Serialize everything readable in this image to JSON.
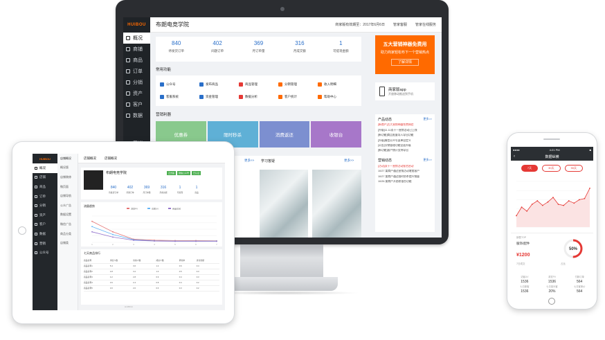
{
  "monitor": {
    "logo": "HUIBOU",
    "title": "布朗电竞学院",
    "expire": "商家版有效期至：2017年6月6日",
    "links": [
      "管家客服",
      "管家在线服务"
    ],
    "nav": [
      "概况",
      "商铺",
      "商品",
      "订单",
      "分销",
      "资产",
      "客户",
      "数据",
      "营销"
    ],
    "stats": [
      {
        "value": "840",
        "label": "待发货订单"
      },
      {
        "value": "402",
        "label": "间题订单"
      },
      {
        "value": "369",
        "label": "月订单量"
      },
      {
        "value": "316",
        "label": "月成交额"
      },
      {
        "value": "1",
        "label": "可提现金额"
      }
    ],
    "banner": {
      "title": "五大营销神器免费用",
      "subtitle": "助力商家轻松布下一个营销热点",
      "button": "了解详情"
    },
    "app": {
      "title": "商家版app",
      "subtitle": "开放移动推送到手机"
    },
    "quick_title": "常用功能",
    "quick": [
      {
        "label": "公众号",
        "color": "#2a6fc9"
      },
      {
        "label": "发布商品",
        "color": "#2a6fc9"
      },
      {
        "label": "商品管理",
        "color": "#e53935"
      },
      {
        "label": "分销管理",
        "color": "#ff6a00"
      },
      {
        "label": "收入明细",
        "color": "#ff6a00"
      },
      {
        "label": "客服系统",
        "color": "#2a6fc9"
      },
      {
        "label": "资金管理",
        "color": "#2a6fc9"
      },
      {
        "label": "数据分析",
        "color": "#e53935"
      },
      {
        "label": "客户统计",
        "color": "#ff6a00"
      },
      {
        "label": "帮助中心",
        "color": "#ff6a00"
      }
    ],
    "tools_title": "营销利器",
    "tools": [
      {
        "label": "优惠券",
        "color": "#89c98d"
      },
      {
        "label": "限时秒杀",
        "color": "#5fb0d6"
      },
      {
        "label": "消费返还",
        "color": "#7c8fd0"
      },
      {
        "label": "收银台",
        "color": "#a777c9"
      }
    ],
    "news_title": "产品动态",
    "news_more": "更多>>",
    "news": [
      {
        "text": "[新商户]五大营销神器免费体验",
        "red": true
      },
      {
        "text": "[升级]11.11双十一营销活动已上线",
        "red": false
      },
      {
        "text": "[新功能]商品批量导入导出功能",
        "red": false
      },
      {
        "text": "[升级]微信公众号菜单自定义",
        "red": false
      },
      {
        "text": "[公告]分销管理功能全面升级",
        "red": false
      },
      {
        "text": "[新功能]客户统计支持导出",
        "red": false
      }
    ],
    "news2_title": "营销动态",
    "news2": [
      {
        "text": "[活动]双十一营销活动报名启动",
        "red": true
      },
      {
        "text": "10/27 某商户通过营销活动增加客户",
        "red": false
      },
      {
        "text": "10/27 某商户通过限时秒杀提升销量",
        "red": false
      },
      {
        "text": "10/26 某商户开启收银台功能",
        "red": false
      }
    ],
    "learn_title": "学习答疑",
    "more": "更多>>"
  },
  "tablet": {
    "logo": "HUIBOU",
    "top_tabs": [
      "店铺概况",
      "店铺概况"
    ],
    "nav": [
      "概况",
      "店铺",
      "商品",
      "订单",
      "分销",
      "资产",
      "客户",
      "数据",
      "营销",
      "公众号"
    ],
    "sub": [
      "店铺概况",
      "概况版",
      "店铺装修",
      "微页面",
      "店铺导航",
      "公众广告",
      "数据设置",
      "微信广告",
      "商品分类",
      "店铺类"
    ],
    "shop_name": "布朗电竞学院",
    "tags": [
      {
        "label": "正式版",
        "color": "#4caf50"
      },
      {
        "label": "微信公众号",
        "color": "#4caf50"
      },
      {
        "label": "已认证",
        "color": "#4caf50"
      }
    ],
    "stats": [
      {
        "value": "840",
        "label": "待发货订单"
      },
      {
        "value": "402",
        "label": "间题订单"
      },
      {
        "value": "369",
        "label": "月订单量"
      },
      {
        "value": "316",
        "label": "月成交额"
      },
      {
        "value": "1",
        "label": "可提现"
      },
      {
        "value": "1",
        "label": "商品"
      }
    ],
    "chart_title": "流量趋势",
    "legend": [
      "浏览PV",
      "访客UV",
      "商品访问"
    ],
    "chart_data": {
      "type": "line",
      "x": [
        "1",
        "2",
        "3",
        "4",
        "5",
        "6",
        "7"
      ],
      "series": [
        {
          "name": "浏览PV",
          "values": [
            80,
            40,
            12,
            8,
            7,
            7,
            6
          ]
        },
        {
          "name": "访客UV",
          "values": [
            60,
            30,
            10,
            6,
            5,
            5,
            5
          ]
        },
        {
          "name": "商品访问",
          "values": [
            40,
            20,
            8,
            5,
            4,
            4,
            4
          ]
        }
      ]
    },
    "table_title": "七天商品排行",
    "table_head": [
      "商品名称",
      "浏览人数",
      "访客人数",
      "成交人数",
      "转化率",
      "支付金额"
    ],
    "table_rows": [
      [
        "商品名称1",
        "5.4",
        "3.6",
        "1.2",
        "0.6",
        "0.4"
      ],
      [
        "商品名称2",
        "4.8",
        "3.2",
        "1.0",
        "0.5",
        "0.3"
      ],
      [
        "商品名称3",
        "4.2",
        "2.8",
        "0.9",
        "0.4",
        "0.3"
      ],
      [
        "商品名称4",
        "3.6",
        "2.4",
        "0.8",
        "0.4",
        "0.2"
      ],
      [
        "商品名称5",
        "3.0",
        "2.0",
        "0.6",
        "0.3",
        "0.2"
      ]
    ],
    "footer": "HUIBOU"
  },
  "phone": {
    "status_left": "●●●●",
    "status_time": "4:21 PM",
    "status_right": "■",
    "title": "数据纵横",
    "tabs": [
      "7天",
      "30天",
      "90天"
    ],
    "chart_data": {
      "type": "area",
      "x": [
        "1",
        "2",
        "3",
        "4",
        "5",
        "6",
        "7",
        "8",
        "9",
        "10",
        "11",
        "12",
        "13",
        "14",
        "15"
      ],
      "series": [
        {
          "name": "",
          "values": [
            20,
            35,
            28,
            40,
            46,
            38,
            44,
            52,
            40,
            38,
            46,
            42,
            48,
            50,
            68
          ]
        }
      ]
    },
    "mid_label": "销售TOP",
    "mid_product": "服饰/配件",
    "mid_price": "¥1200",
    "mid_note": "7日成交",
    "ring_percent": "50%",
    "ring_label": "占比",
    "grid": [
      {
        "label": "访客UV",
        "value": "1536"
      },
      {
        "label": "浏览PV",
        "value": "1536"
      },
      {
        "label": "付款订单",
        "value": "564"
      },
      {
        "label": "七日新客",
        "value": "1536"
      },
      {
        "label": "七日回头客",
        "value": "20%"
      },
      {
        "label": "七日客单价",
        "value": "564"
      }
    ]
  }
}
